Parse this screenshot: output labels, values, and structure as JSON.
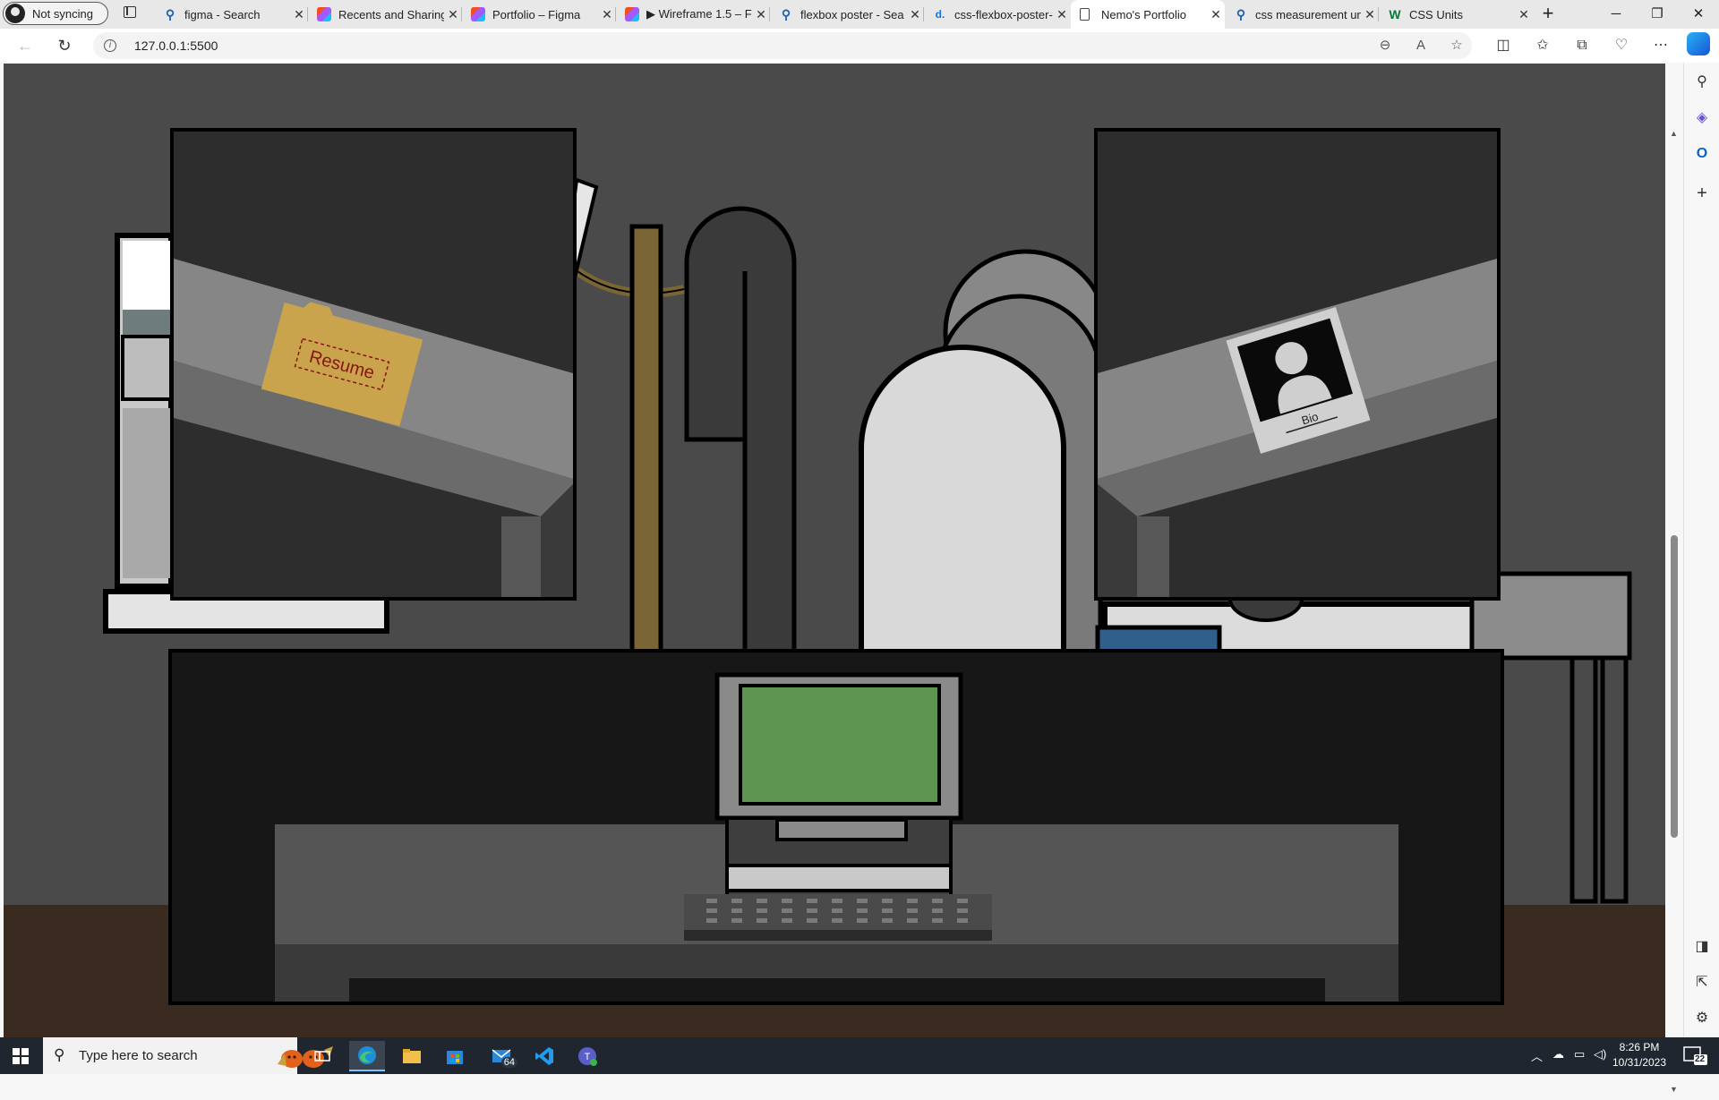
{
  "browser": {
    "profile_label": "Not syncing",
    "tabs": [
      {
        "title": "figma - Search",
        "favicon": "search-icon"
      },
      {
        "title": "Recents and Sharing",
        "favicon": "figma-icon"
      },
      {
        "title": "Portfolio – Figma",
        "favicon": "figma-icon"
      },
      {
        "title": "▶ Wireframe 1.5 – F",
        "favicon": "figma-icon"
      },
      {
        "title": "flexbox poster - Sea",
        "favicon": "search-icon"
      },
      {
        "title": "css-flexbox-poster-",
        "favicon": "d-icon"
      },
      {
        "title": "Nemo's Portfolio",
        "favicon": "page-icon",
        "active": true
      },
      {
        "title": "css measurement un",
        "favicon": "search-icon"
      },
      {
        "title": "CSS Units",
        "favicon": "w3schools-icon"
      }
    ],
    "url": "127.0.0.1:5500"
  },
  "scene": {
    "left_picture": {
      "label": "Resume"
    },
    "right_picture": {
      "label": "Bio"
    },
    "colors": {
      "wall": "#4a4a4a",
      "floor": "#3b2a1f",
      "desk": "#171717",
      "monitor_screen": "#5d9650",
      "folder": "#c9a44c",
      "folder_text": "#8a1414",
      "lamp_pole": "#7a6535",
      "blue_book": "#2f5f8a"
    }
  },
  "taskbar": {
    "search_placeholder": "Type here to search",
    "mail_badge": "64",
    "time": "8:26 PM",
    "date": "10/31/2023",
    "notification_count": "22"
  }
}
